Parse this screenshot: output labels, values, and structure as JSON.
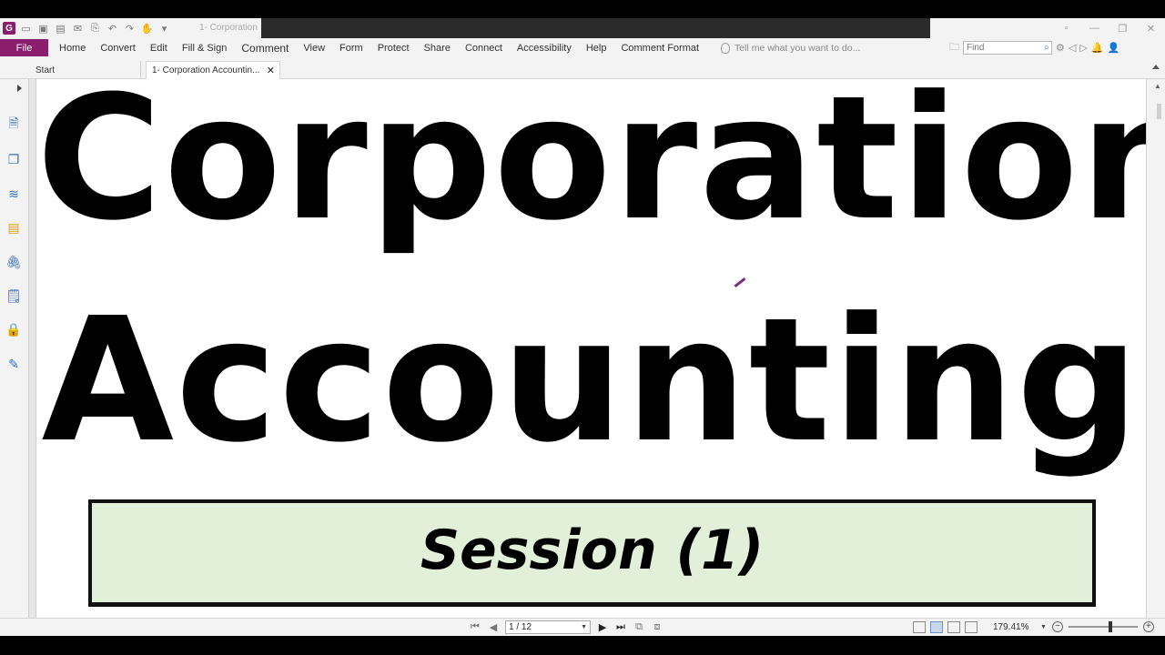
{
  "window": {
    "title": "1- Corporation",
    "controls": [
      "▫",
      "—",
      "❐",
      "✕"
    ]
  },
  "quick_access": [
    "open-icon",
    "save-icon",
    "print-icon",
    "undo-icon",
    "redo-icon",
    "hand-icon"
  ],
  "menu": {
    "file": "File",
    "items": [
      "Home",
      "Convert",
      "Edit",
      "Fill & Sign",
      "Comment",
      "View",
      "Form",
      "Protect",
      "Share",
      "Connect",
      "Accessibility",
      "Help",
      "Comment Format"
    ],
    "tell_me": "Tell me what you want to do...",
    "find_placeholder": "Find"
  },
  "tabs": {
    "start": "Start",
    "document": "1- Corporation Accountin..."
  },
  "document": {
    "line1": "Corporation",
    "line2": "Accounting",
    "session": "Session (1)"
  },
  "status": {
    "page": "1 / 12",
    "zoom": "179.41%"
  },
  "colors": {
    "brand": "#8a1d6c",
    "session_bg": "#e2efd9"
  }
}
